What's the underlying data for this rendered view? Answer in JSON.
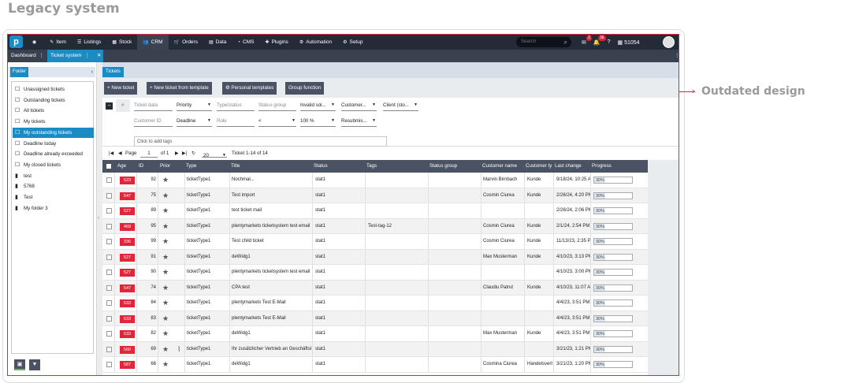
{
  "heading": "Legacy system",
  "callout": "Outdated design",
  "topnav": {
    "logo": "p",
    "items": [
      {
        "icon": "◉",
        "label": ""
      },
      {
        "icon": "✎",
        "label": "Item"
      },
      {
        "icon": "☰",
        "label": "Listings"
      },
      {
        "icon": "▦",
        "label": "Stock"
      },
      {
        "icon": "👥",
        "label": "CRM"
      },
      {
        "icon": "🛒",
        "label": "Orders"
      },
      {
        "icon": "▤",
        "label": "Data"
      },
      {
        "icon": "◔",
        "label": "CMS"
      },
      {
        "icon": "✚",
        "label": "Plugins"
      },
      {
        "icon": "⚙",
        "label": "Automation"
      },
      {
        "icon": "⚙",
        "label": "Setup"
      }
    ],
    "search_placeholder": "Search",
    "notif1_count": "2",
    "notif2_count": "36",
    "help": "?",
    "system_id": "51054"
  },
  "tabbar": {
    "dashboard": "Dashboard",
    "ticket_system": "Ticket system",
    "close": "✕",
    "menu": "⋮"
  },
  "sidebar": {
    "title": "Folder",
    "items": [
      {
        "icon": "☐",
        "label": "Unassigned tickets",
        "selected": false
      },
      {
        "icon": "☐",
        "label": "Outstanding tickets",
        "selected": false
      },
      {
        "icon": "☐",
        "label": "All tickets",
        "selected": false
      },
      {
        "icon": "☐",
        "label": "My tickets",
        "selected": false
      },
      {
        "icon": "☐",
        "label": "My outstanding tickets",
        "selected": true
      },
      {
        "icon": "☐",
        "label": "Deadline today",
        "selected": false
      },
      {
        "icon": "☐",
        "label": "Deadline already exceeded",
        "selected": false
      },
      {
        "icon": "☐",
        "label": "My closed tickets",
        "selected": false
      },
      {
        "icon": "▮",
        "label": "test",
        "selected": false
      },
      {
        "icon": "▮",
        "label": "5768",
        "selected": false
      },
      {
        "icon": "▮",
        "label": "Test",
        "selected": false
      },
      {
        "icon": "▮",
        "label": "My folder 3",
        "selected": false
      }
    ]
  },
  "main": {
    "tab": "Tickets",
    "toolbar": {
      "new_ticket": "+ New ticket",
      "new_from_template": "+ New ticket from template",
      "personal_templates": "Personal templates",
      "group_function": "Group function"
    },
    "filters": {
      "ticket_data": "Ticket data",
      "priority": "Priority",
      "type_status": "Type/status",
      "status_group": "Status group",
      "invalid_sol": "Invalid sol...",
      "customer": "Customer...",
      "client": "Client (sto...",
      "customer_id": "Customer ID",
      "deadline": "Deadline",
      "role": "Role",
      "lt": "<",
      "percent": "100 %",
      "resubmis": "Resubmis...",
      "add_tags": "Click to add tags"
    },
    "pager": {
      "page_label": "Page",
      "page": "1",
      "of": "of 1",
      "page_size": "20",
      "summary": "Ticket 1-14 of 14"
    },
    "columns": [
      "Age",
      "ID",
      "Prior",
      "Type",
      "Title",
      "Status",
      "Tags",
      "Status group",
      "Customer name",
      "Customer ty",
      "Last change",
      "Progress"
    ],
    "rows": [
      {
        "age": "523",
        "id": "92",
        "type": "ticketType1",
        "title": "Nochmal...",
        "status": "stat1",
        "tags": "",
        "customer": "Marvin Birnbach",
        "ctype": "Kunde",
        "last": "9/18/24, 10:25 A",
        "progress": "30%",
        "clip": false
      },
      {
        "age": "547",
        "id": "75",
        "type": "ticketType1",
        "title": "Test import",
        "status": "stat1",
        "tags": "",
        "customer": "Cosmin Ciurea",
        "ctype": "Kunde",
        "last": "2/26/24, 4:20 PM",
        "progress": "30%",
        "clip": false
      },
      {
        "age": "527",
        "id": "89",
        "type": "ticketType1",
        "title": "test ticket mail",
        "status": "stat1",
        "tags": "",
        "customer": "",
        "ctype": "",
        "last": "2/26/24, 2:06 PM",
        "progress": "30%",
        "clip": false
      },
      {
        "age": "469",
        "id": "95",
        "type": "ticketType1",
        "title": "plentymarkets ticketsystem test email 2",
        "status": "stat1",
        "tags": "Test-tag-12",
        "customer": "Cosmin Ciurea",
        "ctype": "Kunde",
        "last": "2/1/24, 2:54 PM",
        "progress": "30%",
        "clip": false
      },
      {
        "age": "336",
        "id": "99",
        "type": "ticketType1",
        "title": "Test child ticket",
        "status": "stat1",
        "tags": "",
        "customer": "Cosmin Ciurea",
        "ctype": "Kunde",
        "last": "11/13/23, 2:35 PM",
        "progress": "30%",
        "clip": false
      },
      {
        "age": "527",
        "id": "91",
        "type": "ticketType1",
        "title": "deWidg1",
        "status": "stat1",
        "tags": "",
        "customer": "Max Musterman",
        "ctype": "Kunde",
        "last": "4/10/23, 3:13 PM",
        "progress": "30%",
        "clip": false
      },
      {
        "age": "527",
        "id": "90",
        "type": "ticketType1",
        "title": "plentymarkets ticketsystem test email 2",
        "status": "stat1",
        "tags": "",
        "customer": "",
        "ctype": "",
        "last": "4/10/23, 3:00 PM",
        "progress": "30%",
        "clip": false
      },
      {
        "age": "547",
        "id": "74",
        "type": "ticketType1",
        "title": "CPA test",
        "status": "stat1",
        "tags": "",
        "customer": "Claudiu Patrut",
        "ctype": "Kunde",
        "last": "4/10/23, 11:07 A",
        "progress": "30%",
        "clip": false
      },
      {
        "age": "533",
        "id": "84",
        "type": "ticketType1",
        "title": "plentymarkets Test E-Mail",
        "status": "stat1",
        "tags": "",
        "customer": "",
        "ctype": "",
        "last": "4/4/23, 3:51 PM",
        "progress": "30%",
        "clip": false
      },
      {
        "age": "533",
        "id": "83",
        "type": "ticketType1",
        "title": "plentymarkets Test E-Mail",
        "status": "stat1",
        "tags": "",
        "customer": "",
        "ctype": "",
        "last": "4/4/23, 3:51 PM",
        "progress": "30%",
        "clip": false
      },
      {
        "age": "533",
        "id": "82",
        "type": "ticketType1",
        "title": "deWidg1",
        "status": "stat1",
        "tags": "",
        "customer": "Max Musterman",
        "ctype": "Kunde",
        "last": "4/4/23, 3:51 PM",
        "progress": "30%",
        "clip": false
      },
      {
        "age": "560",
        "id": "69",
        "type": "ticketType1",
        "title": "Ihr zusätzlicher Vertrieb an Geschäftsk",
        "status": "stat1",
        "tags": "",
        "customer": "",
        "ctype": "",
        "last": "3/21/23, 1:21 PM",
        "progress": "30%",
        "clip": true
      },
      {
        "age": "587",
        "id": "66",
        "type": "ticketType1",
        "title": "deWidg1",
        "status": "stat1",
        "tags": "",
        "customer": "Cosmina Ciurea",
        "ctype": "Handelsvertr",
        "last": "3/21/23, 1:20 PM",
        "progress": "30%",
        "clip": false
      }
    ]
  },
  "colors": {
    "accent": "#1a8cc3",
    "nav": "#232b38",
    "highlight": "#e1253b"
  }
}
